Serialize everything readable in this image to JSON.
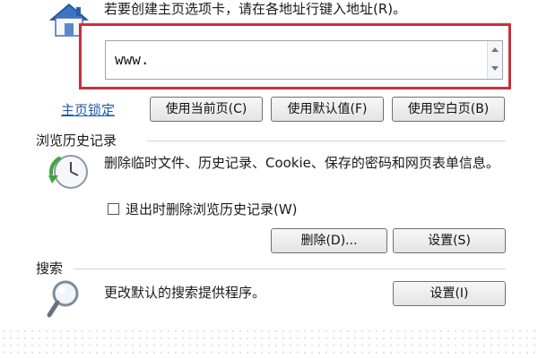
{
  "home_section": {
    "intro_text": "若要创建主页选项卡，请在各地址行键入地址(R)。",
    "url_value": "www.",
    "lock_link": "主页锁定",
    "buttons": {
      "use_current": "使用当前页(C)",
      "use_default": "使用默认值(F)",
      "use_blank": "使用空白页(B)"
    }
  },
  "history_section": {
    "title": "浏览历史记录",
    "description": "删除临时文件、历史记录、Cookie、保存的密码和网页表单信息。",
    "checkbox_label": "退出时删除浏览历史记录(W)",
    "checkbox_checked": false,
    "buttons": {
      "delete": "删除(D)...",
      "settings": "设置(S)"
    }
  },
  "search_section": {
    "title": "搜索",
    "description": "更改默认的搜索提供程序。",
    "buttons": {
      "settings": "设置(I)"
    }
  },
  "icons": {
    "home": "house-icon",
    "history": "clock-icon",
    "search": "magnifier-icon",
    "scroll_up": "scroll-up-arrow-icon",
    "scroll_down": "scroll-down-arrow-icon"
  },
  "colors": {
    "highlight_border": "#c8303a",
    "link": "#1e5aa8"
  }
}
